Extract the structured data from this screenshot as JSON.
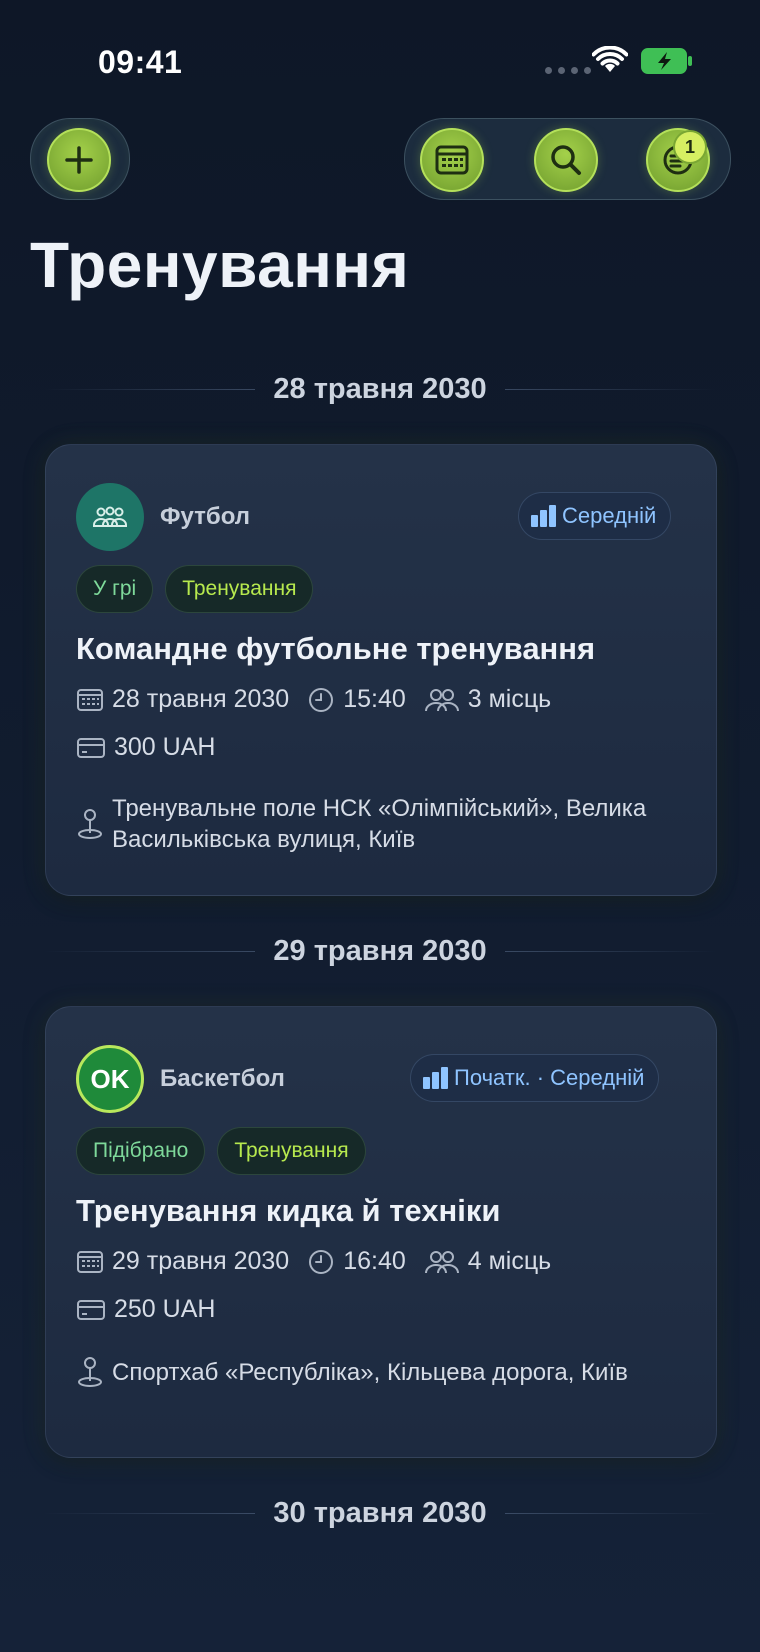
{
  "status_bar": {
    "time": "09:41"
  },
  "header": {
    "title": "Тренування",
    "notifications_count": "1"
  },
  "sections": [
    {
      "date": "28 травня 2030",
      "card": {
        "sport": "Футбол",
        "sport_icon": "team-icon",
        "level": "Середній",
        "tags": [
          "У грі",
          "Тренування"
        ],
        "title": "Командне футбольне тренування",
        "date": "28 травня 2030",
        "time": "15:40",
        "spots": "3 місць",
        "price": "300 UAH",
        "location": "Тренувальне поле НСК «Олімпійський», Велика Васильківська вулиця, Київ"
      }
    },
    {
      "date": "29 травня 2030",
      "card": {
        "sport": "Баскетбол",
        "avatar_text": "OK",
        "level": "Початк. · Середній",
        "tags": [
          "Підібрано",
          "Тренування"
        ],
        "title": "Тренування кидка й техніки",
        "date": "29 травня 2030",
        "time": "16:40",
        "spots": "4 місць",
        "price": "250 UAH",
        "location": "Спортхаб «Республіка», Кільцева дорога, Київ"
      }
    },
    {
      "date": "30 травня 2030"
    }
  ],
  "colors": {
    "accent": "#a4d14a",
    "level_blue": "#8fc4ff",
    "tag_green": "#7ed99a",
    "tag_lime": "#b7e94e"
  }
}
